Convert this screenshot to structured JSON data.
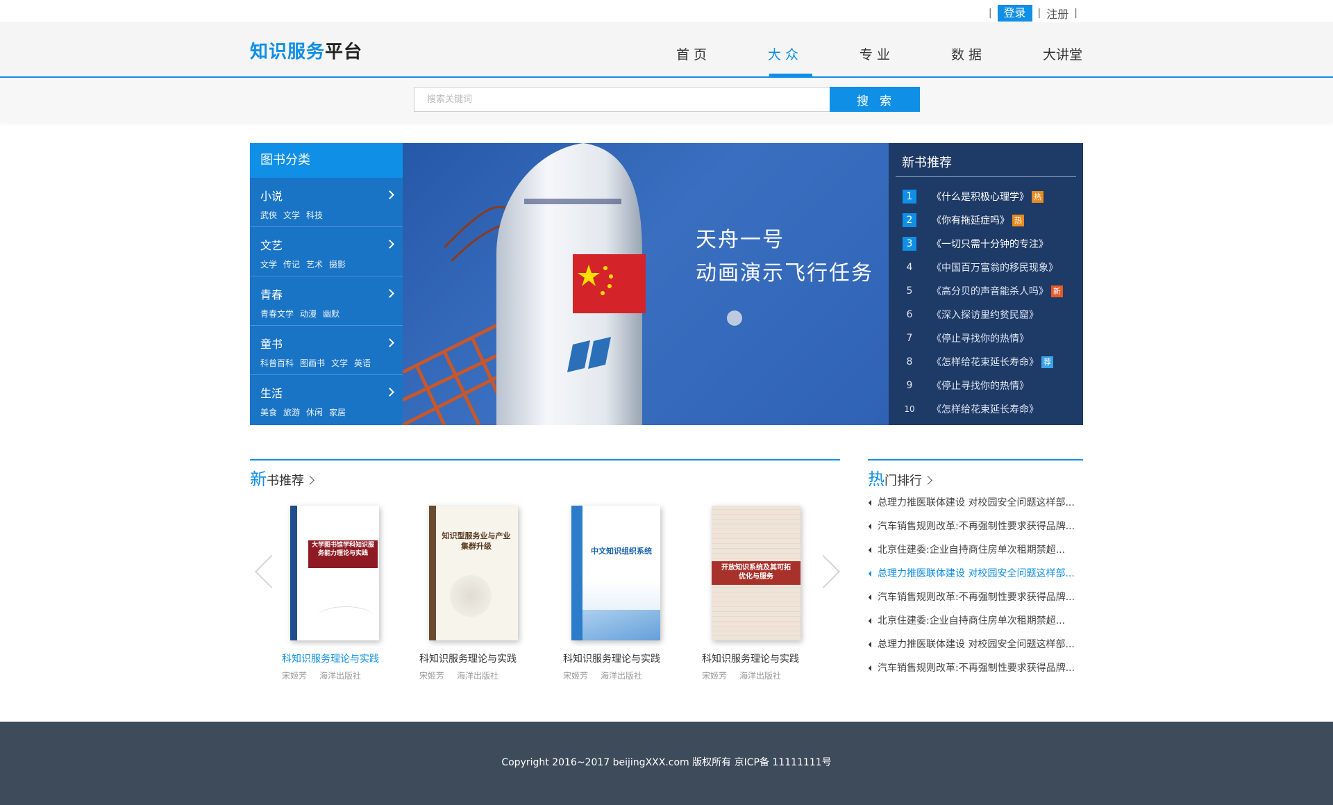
{
  "account": {
    "login_label": "登录",
    "register_label": "注册",
    "separator": "|"
  },
  "logo": {
    "part1": "知识服务",
    "part2": "平台"
  },
  "nav": {
    "items": [
      "首页",
      "大众",
      "专业",
      "数据",
      "大讲堂"
    ],
    "active_index": 1
  },
  "search": {
    "placeholder": "搜索关键词",
    "value": "",
    "button_label": "搜索"
  },
  "categories": {
    "header": "图书分类",
    "items": [
      {
        "title": "小说",
        "tags": [
          "武侠",
          "文学",
          "科技"
        ]
      },
      {
        "title": "文艺",
        "tags": [
          "文学",
          "传记",
          "艺术",
          "摄影"
        ]
      },
      {
        "title": "青春",
        "tags": [
          "青春文学",
          "动漫",
          "幽默"
        ]
      },
      {
        "title": "童书",
        "tags": [
          "科普百科",
          "图画书",
          "文学",
          "英语"
        ]
      },
      {
        "title": "生活",
        "tags": [
          "美食",
          "旅游",
          "休闲",
          "家居"
        ]
      }
    ]
  },
  "banner": {
    "line1": "天舟一号",
    "line2": "动画演示飞行任务"
  },
  "new_books_panel": {
    "title": "新书推荐",
    "items": [
      {
        "rank": "1",
        "title": "《什么是积极心理学》",
        "badge": "热",
        "badge_type": "hot"
      },
      {
        "rank": "2",
        "title": "《你有拖延症吗》",
        "badge": "热",
        "badge_type": "hot"
      },
      {
        "rank": "3",
        "title": "《一切只需十分钟的专注》",
        "badge": "",
        "badge_type": ""
      },
      {
        "rank": "4",
        "title": "《中国百万富翁的移民现象》",
        "badge": "",
        "badge_type": ""
      },
      {
        "rank": "5",
        "title": "《高分贝的声音能杀人吗》",
        "badge": "新",
        "badge_type": "new"
      },
      {
        "rank": "6",
        "title": "《深入探访里约贫民窟》",
        "badge": "",
        "badge_type": ""
      },
      {
        "rank": "7",
        "title": "《停止寻找你的热情》",
        "badge": "",
        "badge_type": ""
      },
      {
        "rank": "8",
        "title": "《怎样给花束延长寿命》",
        "badge": "荐",
        "badge_type": "rec"
      },
      {
        "rank": "9",
        "title": "《停止寻找你的热情》",
        "badge": "",
        "badge_type": ""
      },
      {
        "rank": "10",
        "title": "《怎样给花束延长寿命》",
        "badge": "",
        "badge_type": ""
      }
    ]
  },
  "new_books_section": {
    "title_big": "新",
    "title_rest": "书推荐",
    "books": [
      {
        "title": "科知识服务理论与实践",
        "author": "宋姬芳",
        "publisher": "海洋出版社",
        "cover_title": "大学图书馆学科知识服务能力理论与实践"
      },
      {
        "title": "科知识服务理论与实践",
        "author": "宋姬芳",
        "publisher": "海洋出版社",
        "cover_title": "知识型服务业与产业集群升级"
      },
      {
        "title": "科知识服务理论与实践",
        "author": "宋姬芳",
        "publisher": "海洋出版社",
        "cover_title": "中文知识组织系统"
      },
      {
        "title": "科知识服务理论与实践",
        "author": "宋姬芳",
        "publisher": "海洋出版社",
        "cover_title": "开放知识系统及其可拓优化与服务"
      }
    ]
  },
  "hot_section": {
    "title_big": "热",
    "title_rest": "门排行",
    "items": [
      "总理力推医联体建设 对校园安全问题这样部...",
      "汽车销售规则改革:不再强制性要求获得品牌...",
      "北京住建委:企业自持商住房单次租期禁超...",
      "总理力推医联体建设 对校园安全问题这样部...",
      "汽车销售规则改革:不再强制性要求获得品牌...",
      "北京住建委:企业自持商住房单次租期禁超...",
      "总理力推医联体建设 对校园安全问题这样部...",
      "汽车销售规则改革:不再强制性要求获得品牌..."
    ],
    "active_index": 3
  },
  "footer": {
    "copyright": "Copyright 2016~2017 beijingXXX.com 版权所有 京ICP备 11111111号"
  },
  "colors": {
    "accent": "#0f8fe6",
    "category_bg": "#1a74c5",
    "panel_bg": "#1e3a66",
    "footer_bg": "#3e4b5b"
  }
}
